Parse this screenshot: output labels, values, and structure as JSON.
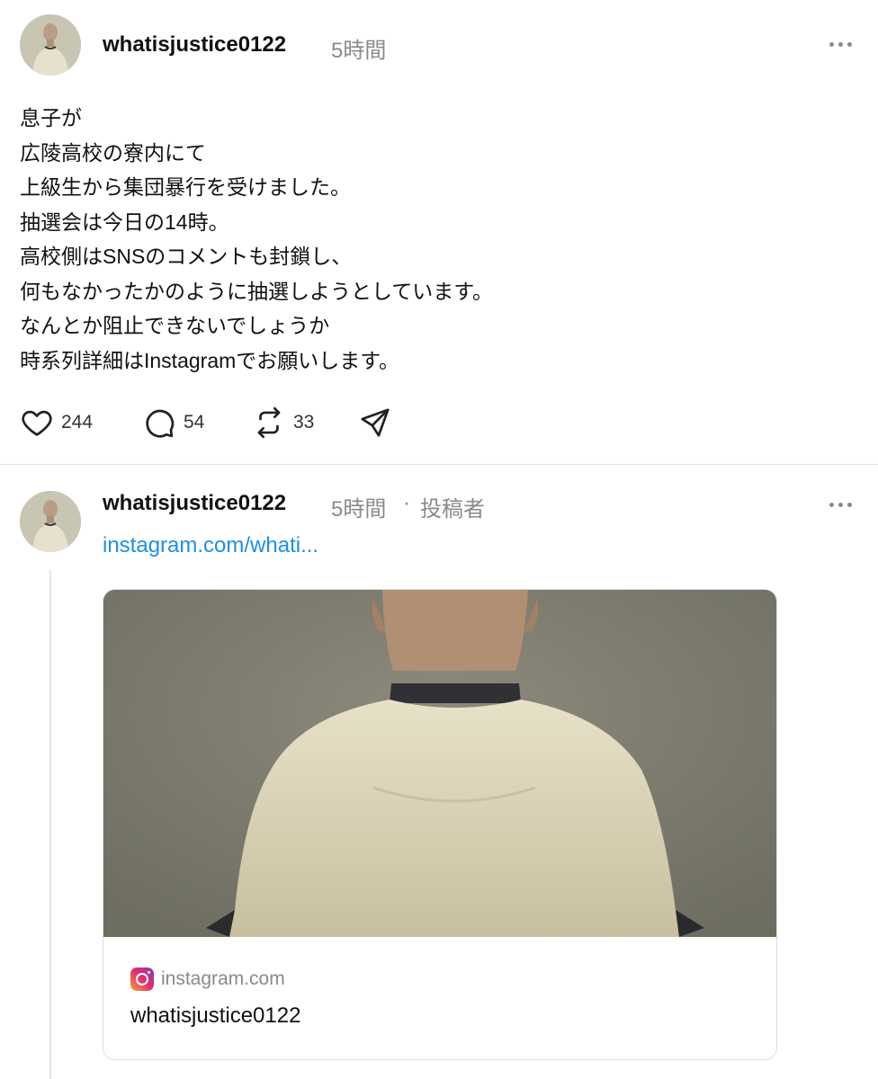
{
  "post1": {
    "username": "whatisjustice0122",
    "time": "5時間",
    "body_lines": [
      "息子が",
      "広陵高校の寮内にて",
      "上級生から集団暴行を受けました。",
      "抽選会は今日の14時。",
      "高校側はSNSのコメントも封鎖し、",
      "何もなかったかのように抽選しようとしています。",
      "なんとか阻止できないでしょうか",
      "時系列詳細はInstagramでお願いします。"
    ],
    "likes": "244",
    "comments": "54",
    "reposts": "33",
    "icons": {
      "like": "heart-icon",
      "comment": "comment-icon",
      "repost": "repost-icon",
      "share": "send-icon",
      "more": "more-icon"
    }
  },
  "post2": {
    "username": "whatisjustice0122",
    "time": "5時間",
    "separator": "·",
    "author_tag": "投稿者",
    "link": "instagram.com/whati...",
    "card": {
      "domain": "instagram.com",
      "title": "whatisjustice0122"
    }
  },
  "colors": {
    "link": "#1d8fe8",
    "muted": "#8a8a8a",
    "divider": "#e3e3e3"
  }
}
